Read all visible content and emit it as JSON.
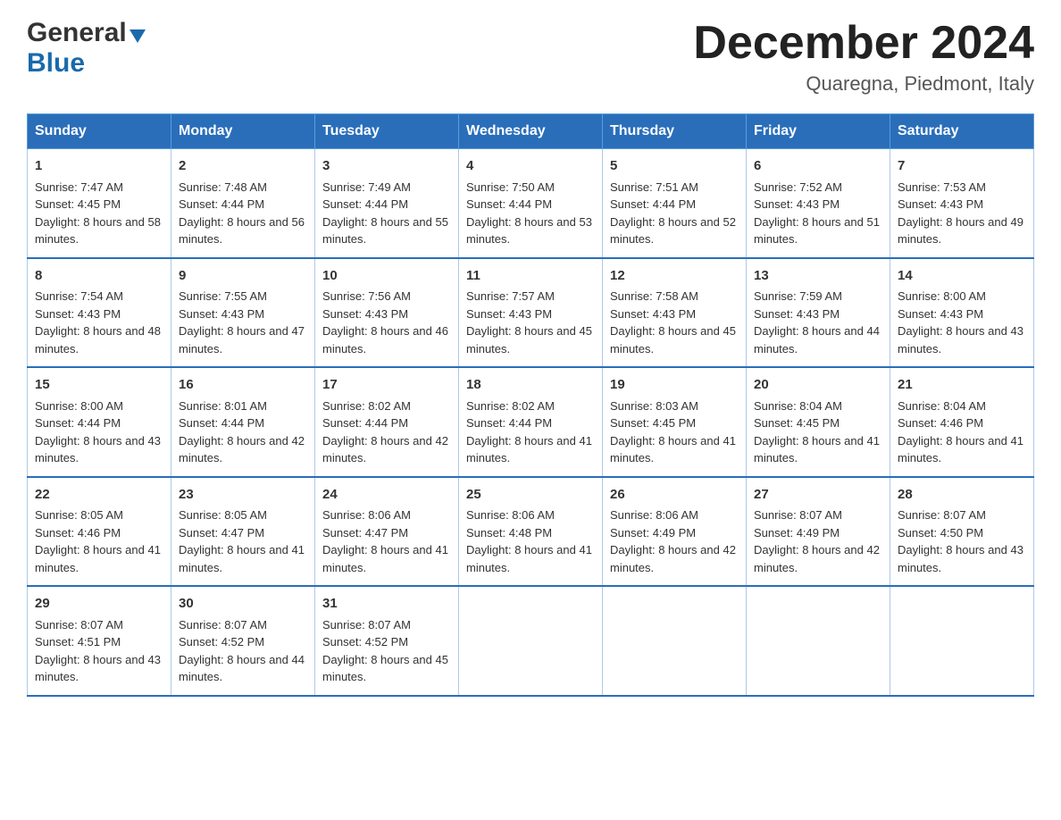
{
  "header": {
    "logo_general": "General",
    "logo_blue": "Blue",
    "month_title": "December 2024",
    "location": "Quaregna, Piedmont, Italy"
  },
  "weekdays": [
    "Sunday",
    "Monday",
    "Tuesday",
    "Wednesday",
    "Thursday",
    "Friday",
    "Saturday"
  ],
  "weeks": [
    [
      {
        "day": "1",
        "sunrise": "7:47 AM",
        "sunset": "4:45 PM",
        "daylight": "8 hours and 58 minutes."
      },
      {
        "day": "2",
        "sunrise": "7:48 AM",
        "sunset": "4:44 PM",
        "daylight": "8 hours and 56 minutes."
      },
      {
        "day": "3",
        "sunrise": "7:49 AM",
        "sunset": "4:44 PM",
        "daylight": "8 hours and 55 minutes."
      },
      {
        "day": "4",
        "sunrise": "7:50 AM",
        "sunset": "4:44 PM",
        "daylight": "8 hours and 53 minutes."
      },
      {
        "day": "5",
        "sunrise": "7:51 AM",
        "sunset": "4:44 PM",
        "daylight": "8 hours and 52 minutes."
      },
      {
        "day": "6",
        "sunrise": "7:52 AM",
        "sunset": "4:43 PM",
        "daylight": "8 hours and 51 minutes."
      },
      {
        "day": "7",
        "sunrise": "7:53 AM",
        "sunset": "4:43 PM",
        "daylight": "8 hours and 49 minutes."
      }
    ],
    [
      {
        "day": "8",
        "sunrise": "7:54 AM",
        "sunset": "4:43 PM",
        "daylight": "8 hours and 48 minutes."
      },
      {
        "day": "9",
        "sunrise": "7:55 AM",
        "sunset": "4:43 PM",
        "daylight": "8 hours and 47 minutes."
      },
      {
        "day": "10",
        "sunrise": "7:56 AM",
        "sunset": "4:43 PM",
        "daylight": "8 hours and 46 minutes."
      },
      {
        "day": "11",
        "sunrise": "7:57 AM",
        "sunset": "4:43 PM",
        "daylight": "8 hours and 45 minutes."
      },
      {
        "day": "12",
        "sunrise": "7:58 AM",
        "sunset": "4:43 PM",
        "daylight": "8 hours and 45 minutes."
      },
      {
        "day": "13",
        "sunrise": "7:59 AM",
        "sunset": "4:43 PM",
        "daylight": "8 hours and 44 minutes."
      },
      {
        "day": "14",
        "sunrise": "8:00 AM",
        "sunset": "4:43 PM",
        "daylight": "8 hours and 43 minutes."
      }
    ],
    [
      {
        "day": "15",
        "sunrise": "8:00 AM",
        "sunset": "4:44 PM",
        "daylight": "8 hours and 43 minutes."
      },
      {
        "day": "16",
        "sunrise": "8:01 AM",
        "sunset": "4:44 PM",
        "daylight": "8 hours and 42 minutes."
      },
      {
        "day": "17",
        "sunrise": "8:02 AM",
        "sunset": "4:44 PM",
        "daylight": "8 hours and 42 minutes."
      },
      {
        "day": "18",
        "sunrise": "8:02 AM",
        "sunset": "4:44 PM",
        "daylight": "8 hours and 41 minutes."
      },
      {
        "day": "19",
        "sunrise": "8:03 AM",
        "sunset": "4:45 PM",
        "daylight": "8 hours and 41 minutes."
      },
      {
        "day": "20",
        "sunrise": "8:04 AM",
        "sunset": "4:45 PM",
        "daylight": "8 hours and 41 minutes."
      },
      {
        "day": "21",
        "sunrise": "8:04 AM",
        "sunset": "4:46 PM",
        "daylight": "8 hours and 41 minutes."
      }
    ],
    [
      {
        "day": "22",
        "sunrise": "8:05 AM",
        "sunset": "4:46 PM",
        "daylight": "8 hours and 41 minutes."
      },
      {
        "day": "23",
        "sunrise": "8:05 AM",
        "sunset": "4:47 PM",
        "daylight": "8 hours and 41 minutes."
      },
      {
        "day": "24",
        "sunrise": "8:06 AM",
        "sunset": "4:47 PM",
        "daylight": "8 hours and 41 minutes."
      },
      {
        "day": "25",
        "sunrise": "8:06 AM",
        "sunset": "4:48 PM",
        "daylight": "8 hours and 41 minutes."
      },
      {
        "day": "26",
        "sunrise": "8:06 AM",
        "sunset": "4:49 PM",
        "daylight": "8 hours and 42 minutes."
      },
      {
        "day": "27",
        "sunrise": "8:07 AM",
        "sunset": "4:49 PM",
        "daylight": "8 hours and 42 minutes."
      },
      {
        "day": "28",
        "sunrise": "8:07 AM",
        "sunset": "4:50 PM",
        "daylight": "8 hours and 43 minutes."
      }
    ],
    [
      {
        "day": "29",
        "sunrise": "8:07 AM",
        "sunset": "4:51 PM",
        "daylight": "8 hours and 43 minutes."
      },
      {
        "day": "30",
        "sunrise": "8:07 AM",
        "sunset": "4:52 PM",
        "daylight": "8 hours and 44 minutes."
      },
      {
        "day": "31",
        "sunrise": "8:07 AM",
        "sunset": "4:52 PM",
        "daylight": "8 hours and 45 minutes."
      },
      null,
      null,
      null,
      null
    ]
  ]
}
